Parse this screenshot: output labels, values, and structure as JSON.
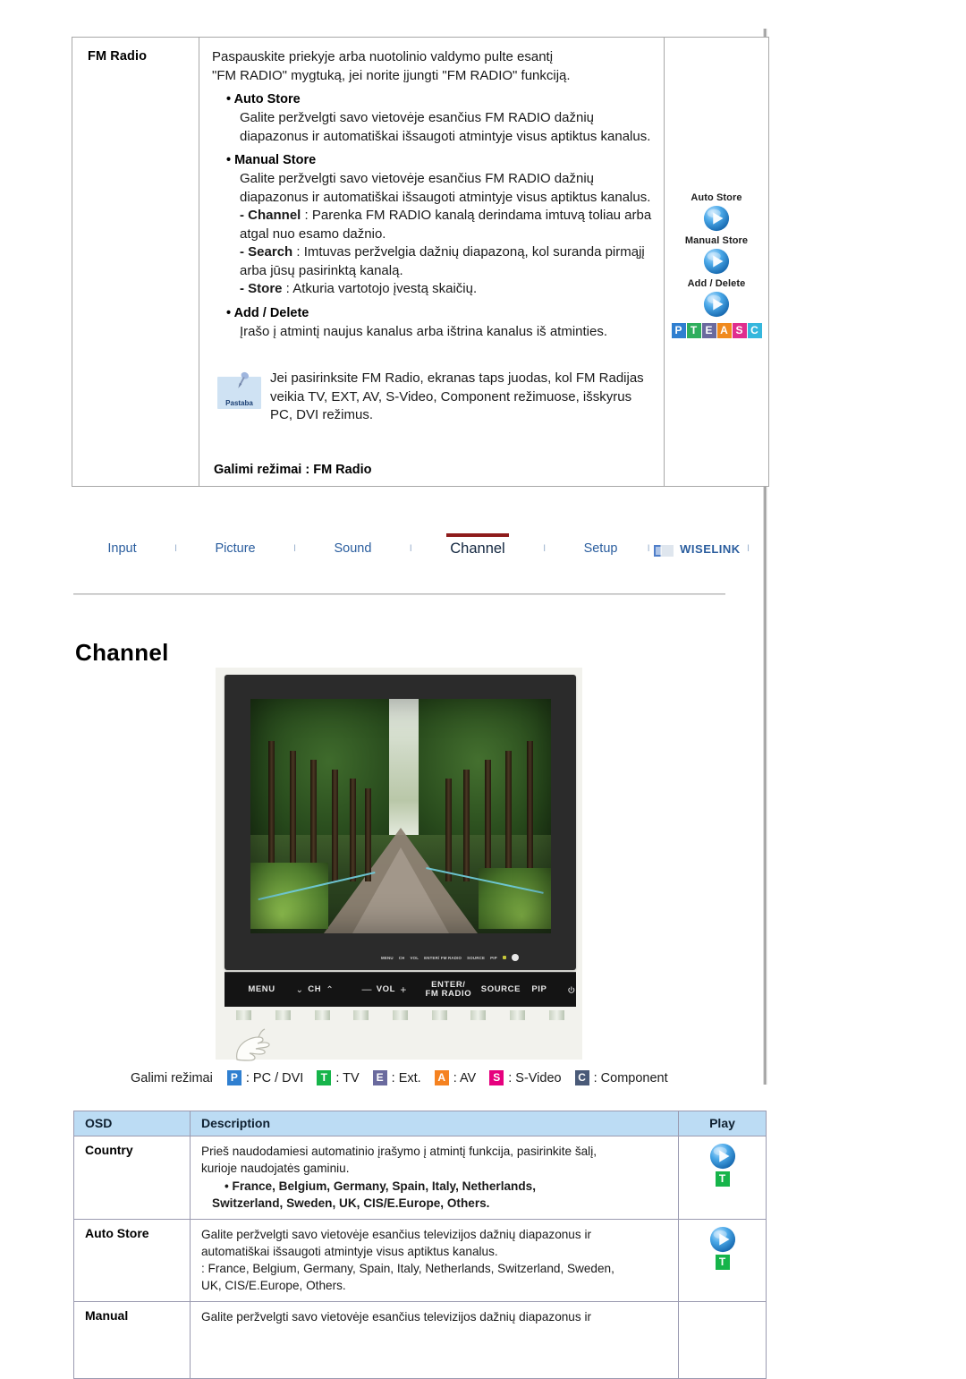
{
  "spec": {
    "name": "FM Radio",
    "intro_line1": "Paspauskite priekyje arba nuotolinio valdymo pulte esantį",
    "intro_line2": "\"FM RADIO\" mygtuką, jei norite įjungti \"FM RADIO\" funkciją.",
    "items": [
      {
        "heading": "• Auto Store",
        "body": "Galite peržvelgti savo vietovėje esančius FM RADIO dažnių diapazonus ir automatiškai išsaugoti atmintyje visus aptiktus kanalus."
      },
      {
        "heading": "• Manual Store",
        "body": "Galite peržvelgti savo vietovėje esančius FM RADIO dažnių diapazonus ir automatiškai išsaugoti atmintyje visus aptiktus kanalus."
      }
    ],
    "sub_items": [
      {
        "label": "- Channel",
        "sep": " : ",
        "text": "Parenka FM RADIO kanalą derindama imtuvą toliau arba atgal nuo esamo dažnio."
      },
      {
        "label": "- Search",
        "sep": " : ",
        "text": "Imtuvas peržvelgia dažnių diapazoną, kol suranda pirmąjį arba jūsų pasirinktą kanalą."
      },
      {
        "label": "- Store",
        "sep": " : ",
        "text": "Atkuria vartotojo įvestą skaičių."
      }
    ],
    "add_delete_heading": "• Add / Delete",
    "add_delete_body": "Įrašo į atmintį naujus kanalus arba ištrina kanalus iš atminties.",
    "note_icon_label": "Pastaba",
    "note_text": "Jei pasirinksite FM Radio, ekranas taps juodas, kol FM Radijas veikia TV, EXT, AV, S-Video, Component režimuose, išskyrus PC, DVI režimus.",
    "available_modes": "Galimi režimai : FM Radio",
    "play_captions": [
      "Auto Store",
      "Manual Store",
      "Add / Delete"
    ],
    "mode_strip": [
      {
        "letter": "P",
        "color": "#2f7fd0"
      },
      {
        "letter": "T",
        "color": "#2fae5e"
      },
      {
        "letter": "E",
        "color": "#6a6a9e"
      },
      {
        "letter": "A",
        "color": "#f08a1e"
      },
      {
        "letter": "S",
        "color": "#e02e8e"
      },
      {
        "letter": "C",
        "color": "#35b7dd"
      }
    ]
  },
  "nav": {
    "items": [
      {
        "label": "Input",
        "active": false
      },
      {
        "label": "Picture",
        "active": false
      },
      {
        "label": "Sound",
        "active": false
      },
      {
        "label": "Channel",
        "active": true
      },
      {
        "label": "Setup",
        "active": false
      }
    ],
    "separator": "I",
    "wiselink_logo": "wiselink-logo-icon",
    "wiselink_label": "WISELINK",
    "accent_color": "#8e1b1b",
    "link_color": "#2a5d9e"
  },
  "page_title": "Channel",
  "tv": {
    "panel_buttons": [
      {
        "label": "MENU"
      },
      {
        "label": "CH",
        "prefix": "chevron-down-icon",
        "suffix": "chevron-up-icon"
      },
      {
        "label": "VOL",
        "prefix": "minus-icon",
        "suffix": "plus-icon"
      },
      {
        "label": "ENTER/",
        "label2": "FM RADIO"
      },
      {
        "label": "SOURCE"
      },
      {
        "label": "PIP"
      },
      {
        "label": "power-icon"
      }
    ],
    "mini_labels": [
      "MENU",
      "CH",
      "VOL",
      "ENTER/ FM RADIO",
      "SOURCE",
      "PIP"
    ],
    "screen_image": "tree-lined-garden-path-photo"
  },
  "legend": {
    "label": "Galimi režimai",
    "items": [
      {
        "letter": "P",
        "color": "#2f7fd0",
        "text": ": PC / DVI"
      },
      {
        "letter": "T",
        "color": "#16b44a",
        "text": ": TV"
      },
      {
        "letter": "E",
        "color": "#6a6a9e",
        "text": ": Ext."
      },
      {
        "letter": "A",
        "color": "#f58220",
        "text": ": AV"
      },
      {
        "letter": "S",
        "color": "#e6007e",
        "text": ": S-Video"
      },
      {
        "letter": "C",
        "color": "#4a5a78",
        "text": ": Component"
      }
    ]
  },
  "osd_table": {
    "headers": [
      "OSD",
      "Description",
      "Play"
    ],
    "header_bg": "#bcdcf4",
    "rows": [
      {
        "osd": "Country",
        "desc_lines": [
          "Prieš naudodamiesi automatinio įrašymo į atmintį funkcija, pasirinkite šalį,",
          "kurioje naudojatės gaminiu."
        ],
        "bold_lines": [
          "• France, Belgium, Germany, Spain, Italy, Netherlands,",
          "Switzerland, Sweden, UK, CIS/E.Europe, Others."
        ],
        "play": true,
        "mode": {
          "letter": "T",
          "color": "#16b44a"
        }
      },
      {
        "osd": "Auto Store",
        "desc_lines": [
          "Galite peržvelgti savo vietovėje esančius televizijos dažnių diapazonus ir",
          "automatiškai išsaugoti atmintyje visus aptiktus kanalus.",
          ": France, Belgium, Germany, Spain, Italy, Netherlands, Switzerland, Sweden,",
          "UK, CIS/E.Europe, Others."
        ],
        "bold_lines": [],
        "play": true,
        "mode": {
          "letter": "T",
          "color": "#16b44a"
        }
      },
      {
        "osd": "Manual",
        "desc_lines": [
          "Galite peržvelgti savo vietovėje esančius televizijos dažnių diapazonus ir"
        ],
        "bold_lines": [],
        "play": false,
        "mode": null
      }
    ]
  }
}
